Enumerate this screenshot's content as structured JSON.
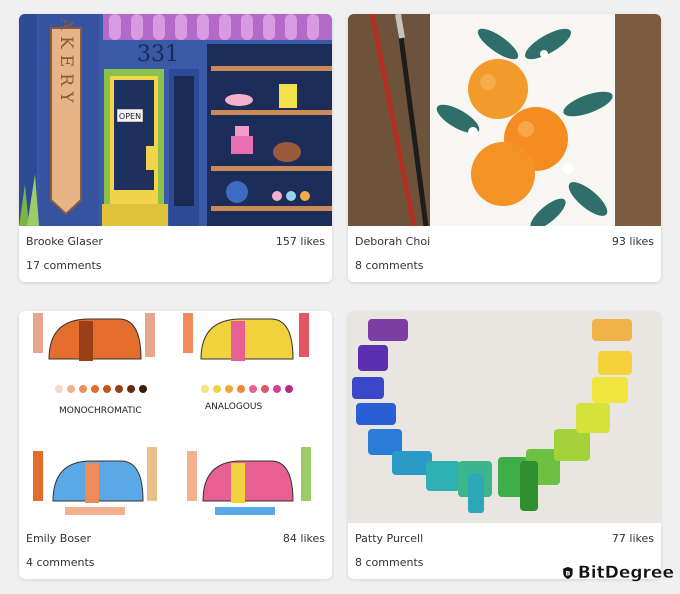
{
  "cards": [
    {
      "author": "Brooke Glaser",
      "likes": "157 likes",
      "comments": "17 comments",
      "image": {
        "sign": "BAKERY",
        "number": "331",
        "door_sign": "OPEN"
      }
    },
    {
      "author": "Deborah Choi",
      "likes": "93 likes",
      "comments": "8 comments"
    },
    {
      "author": "Emily Boser",
      "likes": "84 likes",
      "comments": "4 comments",
      "image": {
        "label_left": "MONOCHROMATIC",
        "label_right": "ANALOGOUS"
      }
    },
    {
      "author": "Patty Purcell",
      "likes": "77 likes",
      "comments": "8 comments"
    }
  ],
  "brand": {
    "name": "BitDegree",
    "icon": "shield-b-icon"
  },
  "colors": {
    "background": "#f0f0f0",
    "card": "#ffffff",
    "text": "#333333"
  }
}
